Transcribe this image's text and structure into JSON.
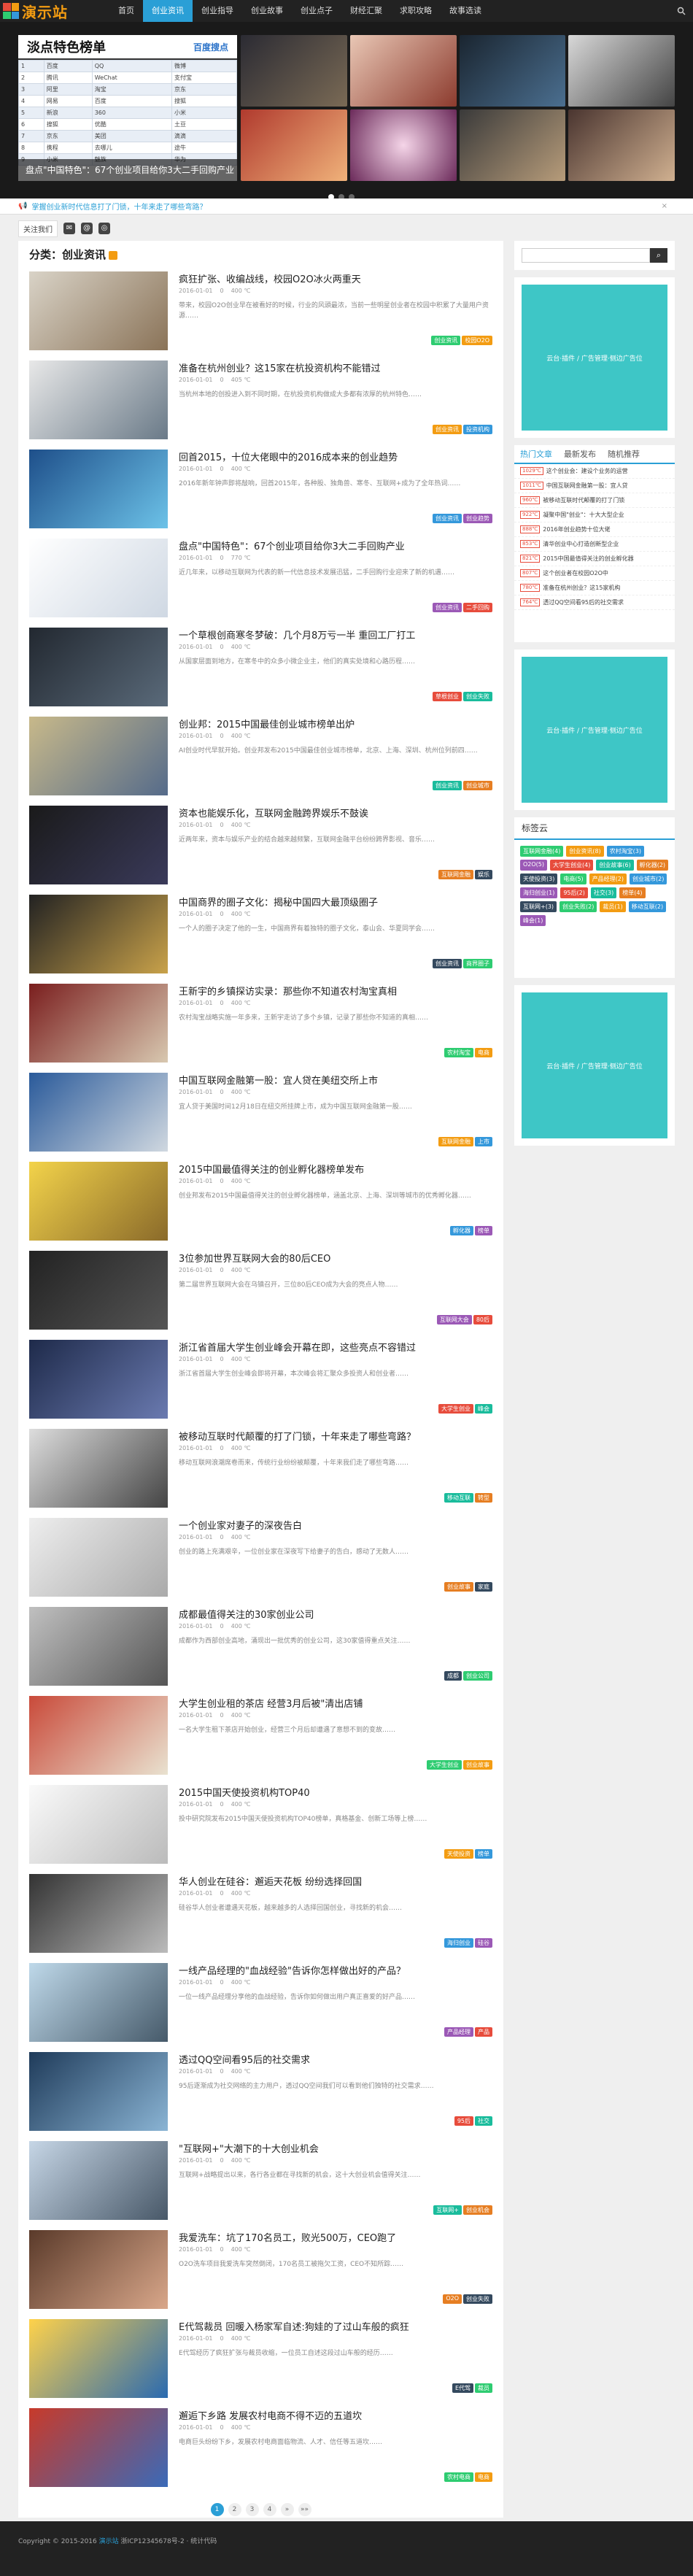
{
  "brand": {
    "logo_text": "演示站"
  },
  "nav": {
    "items": [
      "首页",
      "创业资讯",
      "创业指导",
      "创业故事",
      "创业点子",
      "财经汇聚",
      "求职攻略",
      "故事选读"
    ],
    "active": 1
  },
  "banner": {
    "slide_header": "淡点特色榜单",
    "slide_header_right": "百度搜点",
    "caption": "盘点\"中国特色\"：67个创业项目给你3大二手回购产业",
    "table": [
      [
        "1",
        "百度",
        "QQ",
        "微博"
      ],
      [
        "2",
        "腾讯",
        "WeChat",
        "支付宝"
      ],
      [
        "3",
        "阿里",
        "淘宝",
        "京东"
      ],
      [
        "4",
        "网易",
        "百度",
        "搜狐"
      ],
      [
        "5",
        "新浪",
        "360",
        "小米"
      ],
      [
        "6",
        "搜狐",
        "优酷",
        "土豆"
      ],
      [
        "7",
        "京东",
        "美团",
        "滴滴"
      ],
      [
        "8",
        "携程",
        "去哪儿",
        "途牛"
      ],
      [
        "9",
        "小米",
        "魅族",
        "华为"
      ]
    ]
  },
  "notice": {
    "text": "掌握创业新时代信息打了门锁，十年来走了哪些弯路？",
    "close": "×"
  },
  "social": {
    "follow_label": "关注我们"
  },
  "main": {
    "title": "分类：创业资讯"
  },
  "posts": [
    {
      "title": "疯狂扩张、收编战线，校园O2O冰火两重天",
      "date": "2016-01-01",
      "comments": "0",
      "views": "400 ℃",
      "excerpt": "带来，校园O2O创业早在被看好的时候，行业的风頭最浓，当前一些明星创业者在校园中积累了大量用户资源……",
      "tags": [
        "创业资讯",
        "校园O2O"
      ]
    },
    {
      "title": "准备在杭州创业？这15家在杭投资机构不能错过",
      "date": "2016-01-01",
      "comments": "0",
      "views": "405 ℃",
      "excerpt": "当杭州本地的创投进入到不同时期，在杭投资机构做成大多都有浓厚的杭州特色……",
      "tags": [
        "创业资讯",
        "投资机构"
      ]
    },
    {
      "title": "回首2015，十位大佬眼中的2016成本来的创业趋势",
      "date": "2016-01-01",
      "comments": "0",
      "views": "400 ℃",
      "excerpt": "2016年新年钟声即将敲响，回首2015年，各种股、独角兽、寒冬、互联网+成为了全年热词……",
      "tags": [
        "创业资讯",
        "创业趋势"
      ]
    },
    {
      "title": "盘点\"中国特色\"：67个创业项目给你3大二手回购产业",
      "date": "2016-01-01",
      "comments": "0",
      "views": "770 ℃",
      "excerpt": "近几年来，以移动互联网为代表的新一代信息技术发展迅猛，二手回购行业迎来了新的机遇……",
      "tags": [
        "创业资讯",
        "二手回购"
      ]
    },
    {
      "title": "一个草根创商寒冬梦破：几个月8万亏一半 重回工厂打工",
      "date": "2016-01-01",
      "comments": "0",
      "views": "400 ℃",
      "excerpt": "从国家层面到地方，在寒冬中的众多小微企业主，他们的真实处境和心路历程……",
      "tags": [
        "草根创业",
        "创业失败"
      ]
    },
    {
      "title": "创业邦：2015中国最佳创业城市榜单出炉",
      "date": "2016-01-01",
      "comments": "0",
      "views": "400 ℃",
      "excerpt": "AI创业时代早就开始。创业邦发布2015中国最佳创业城市榜单，北京、上海、深圳、杭州位列前四……",
      "tags": [
        "创业资讯",
        "创业城市"
      ]
    },
    {
      "title": "资本也能娱乐化，互联网金融跨界娱乐不鼓诶",
      "date": "2016-01-01",
      "comments": "0",
      "views": "400 ℃",
      "excerpt": "近两年来，资本与娱乐产业的结合越来越频繁，互联网金融平台纷纷跨界影视、音乐……",
      "tags": [
        "互联网金融",
        "娱乐"
      ]
    },
    {
      "title": "中国商界的圈子文化：揭秘中国四大最顶级圈子",
      "date": "2016-01-01",
      "comments": "0",
      "views": "400 ℃",
      "excerpt": "一个人的圈子决定了他的一生，中国商界有着独特的圈子文化，泰山会、华夏同学会……",
      "tags": [
        "创业资讯",
        "商界圈子"
      ]
    },
    {
      "title": "王新宇的乡镇探访实录：那些你不知道农村淘宝真相",
      "date": "2016-01-01",
      "comments": "0",
      "views": "400 ℃",
      "excerpt": "农村淘宝战略实施一年多来，王新宇走访了多个乡镇，记录了那些你不知道的真相……",
      "tags": [
        "农村淘宝",
        "电商"
      ]
    },
    {
      "title": "中国互联网金融第一股：宜人贷在美纽交所上市",
      "date": "2016-01-01",
      "comments": "0",
      "views": "400 ℃",
      "excerpt": "宜人贷于美国时间12月18日在纽交所挂牌上市，成为中国互联网金融第一股……",
      "tags": [
        "互联网金融",
        "上市"
      ]
    },
    {
      "title": "2015中国最值得关注的创业孵化器榜单发布",
      "date": "2016-01-01",
      "comments": "0",
      "views": "400 ℃",
      "excerpt": "创业邦发布2015中国最值得关注的创业孵化器榜单，涵盖北京、上海、深圳等城市的优秀孵化器……",
      "tags": [
        "孵化器",
        "榜单"
      ]
    },
    {
      "title": "3位参加世界互联网大会的80后CEO",
      "date": "2016-01-01",
      "comments": "0",
      "views": "400 ℃",
      "excerpt": "第二届世界互联网大会在乌镇召开，三位80后CEO成为大会的亮点人物……",
      "tags": [
        "互联网大会",
        "80后"
      ]
    },
    {
      "title": "浙江省首届大学生创业峰会开幕在即，这些亮点不容错过",
      "date": "2016-01-01",
      "comments": "0",
      "views": "400 ℃",
      "excerpt": "浙江省首届大学生创业峰会即将开幕，本次峰会将汇聚众多投资人和创业者……",
      "tags": [
        "大学生创业",
        "峰会"
      ]
    },
    {
      "title": "被移动互联时代颠覆的打了门锁，十年来走了哪些弯路？",
      "date": "2016-01-01",
      "comments": "0",
      "views": "400 ℃",
      "excerpt": "移动互联网浪潮席卷而来，传统行业纷纷被颠覆，十年来我们走了哪些弯路……",
      "tags": [
        "移动互联",
        "转型"
      ]
    },
    {
      "title": "一个创业家对妻子的深夜告白",
      "date": "2016-01-01",
      "comments": "0",
      "views": "400 ℃",
      "excerpt": "创业的路上充满艰辛，一位创业家在深夜写下给妻子的告白，感动了无数人……",
      "tags": [
        "创业故事",
        "家庭"
      ]
    },
    {
      "title": "成都最值得关注的30家创业公司",
      "date": "2016-01-01",
      "comments": "0",
      "views": "400 ℃",
      "excerpt": "成都作为西部创业高地，涌现出一批优秀的创业公司，这30家值得重点关注……",
      "tags": [
        "成都",
        "创业公司"
      ]
    },
    {
      "title": "大学生创业租的茶店 经营3月后被\"清出店铺",
      "date": "2016-01-01",
      "comments": "0",
      "views": "400 ℃",
      "excerpt": "一名大学生租下茶店开始创业，经营三个月后却遭遇了意想不到的变故……",
      "tags": [
        "大学生创业",
        "创业故事"
      ]
    },
    {
      "title": "2015中国天使投资机构TOP40",
      "date": "2016-01-01",
      "comments": "0",
      "views": "400 ℃",
      "excerpt": "投中研究院发布2015中国天使投资机构TOP40榜单，真格基金、创新工场等上榜……",
      "tags": [
        "天使投资",
        "榜单"
      ]
    },
    {
      "title": "华人创业在硅谷：邂逅天花板 纷纷选择回国",
      "date": "2016-01-01",
      "comments": "0",
      "views": "400 ℃",
      "excerpt": "硅谷华人创业者遭遇天花板，越来越多的人选择回国创业，寻找新的机会……",
      "tags": [
        "海归创业",
        "硅谷"
      ]
    },
    {
      "title": "一线产品经理的\"血战经验\"告诉你怎样做出好的产品？",
      "date": "2016-01-01",
      "comments": "0",
      "views": "400 ℃",
      "excerpt": "一位一线产品经理分享他的血战经验，告诉你如何做出用户真正喜爱的好产品……",
      "tags": [
        "产品经理",
        "产品"
      ]
    },
    {
      "title": "透过QQ空间看95后的社交需求",
      "date": "2016-01-01",
      "comments": "0",
      "views": "400 ℃",
      "excerpt": "95后逐渐成为社交网络的主力用户，透过QQ空间我们可以看到他们独特的社交需求……",
      "tags": [
        "95后",
        "社交"
      ]
    },
    {
      "title": "\"互联网+\"大潮下的十大创业机会",
      "date": "2016-01-01",
      "comments": "0",
      "views": "400 ℃",
      "excerpt": "互联网+战略提出以来，各行各业都在寻找新的机会，这十大创业机会值得关注……",
      "tags": [
        "互联网+",
        "创业机会"
      ]
    },
    {
      "title": "我爱洗车：坑了170名员工，败光500万，CEO跑了",
      "date": "2016-01-01",
      "comments": "0",
      "views": "400 ℃",
      "excerpt": "O2O洗车项目我爱洗车突然倒闭，170名员工被拖欠工资，CEO不知所踪……",
      "tags": [
        "O2O",
        "创业失败"
      ]
    },
    {
      "title": "E代驾裁员 回暖入杨家军自述:狗娃的了过山车般的疯狂",
      "date": "2016-01-01",
      "comments": "0",
      "views": "400 ℃",
      "excerpt": "E代驾经历了疯狂扩张与裁员收缩，一位员工自述这段过山车般的经历……",
      "tags": [
        "E代驾",
        "裁员"
      ]
    },
    {
      "title": "邂逅下乡路 发展农村电商不得不迈的五道坎",
      "date": "2016-01-01",
      "comments": "0",
      "views": "400 ℃",
      "excerpt": "电商巨头纷纷下乡，发展农村电商面临物流、人才、信任等五道坎……",
      "tags": [
        "农村电商",
        "电商"
      ]
    }
  ],
  "pager": [
    "1",
    "2",
    "3",
    "4",
    "»",
    "»»"
  ],
  "sidebar": {
    "search_button": "⌕",
    "ad_text": "云台·插件 / 广告管理·侧边广告位",
    "tabs": [
      "热门文章",
      "最新发布",
      "随机推荐"
    ],
    "hot": [
      {
        "deg": "1029℃",
        "text": "这个创业会：建设个业务的运营"
      },
      {
        "deg": "1011℃",
        "text": "中国互联网金融第一股：宜人贷"
      },
      {
        "deg": "960℃",
        "text": "被移动互联时代颠覆的打了门锁"
      },
      {
        "deg": "922℃",
        "text": "凝聚中国\"创业\"：十大大型企业"
      },
      {
        "deg": "888℃",
        "text": "2016年创业趋势十位大佬"
      },
      {
        "deg": "853℃",
        "text": "清华创业中心打造创新型企业"
      },
      {
        "deg": "821℃",
        "text": "2015中国最值得关注的创业孵化器"
      },
      {
        "deg": "807℃",
        "text": "这个创业者在校园O2O中"
      },
      {
        "deg": "780℃",
        "text": "准备在杭州创业？这15家机构"
      },
      {
        "deg": "764℃",
        "text": "透过QQ空间看95后的社交需求"
      }
    ],
    "tag_title": "标签云",
    "tagcloud": [
      "互联网金融(4)",
      "创业资讯(8)",
      "农村淘宝(3)",
      "O2O(5)",
      "大学生创业(4)",
      "创业故事(6)",
      "孵化器(2)",
      "天使投资(3)",
      "电商(5)",
      "产品经理(2)",
      "创业城市(2)",
      "海归创业(1)",
      "95后(2)",
      "社交(3)",
      "榜单(4)",
      "互联网+(3)",
      "创业失败(2)",
      "裁员(1)",
      "移动互联(2)",
      "峰会(1)"
    ]
  },
  "footer": {
    "copyright": "Copyright © 2015-2016",
    "site": "演示站",
    "icp": "浙ICP12345678号-2 · 统计代码"
  }
}
